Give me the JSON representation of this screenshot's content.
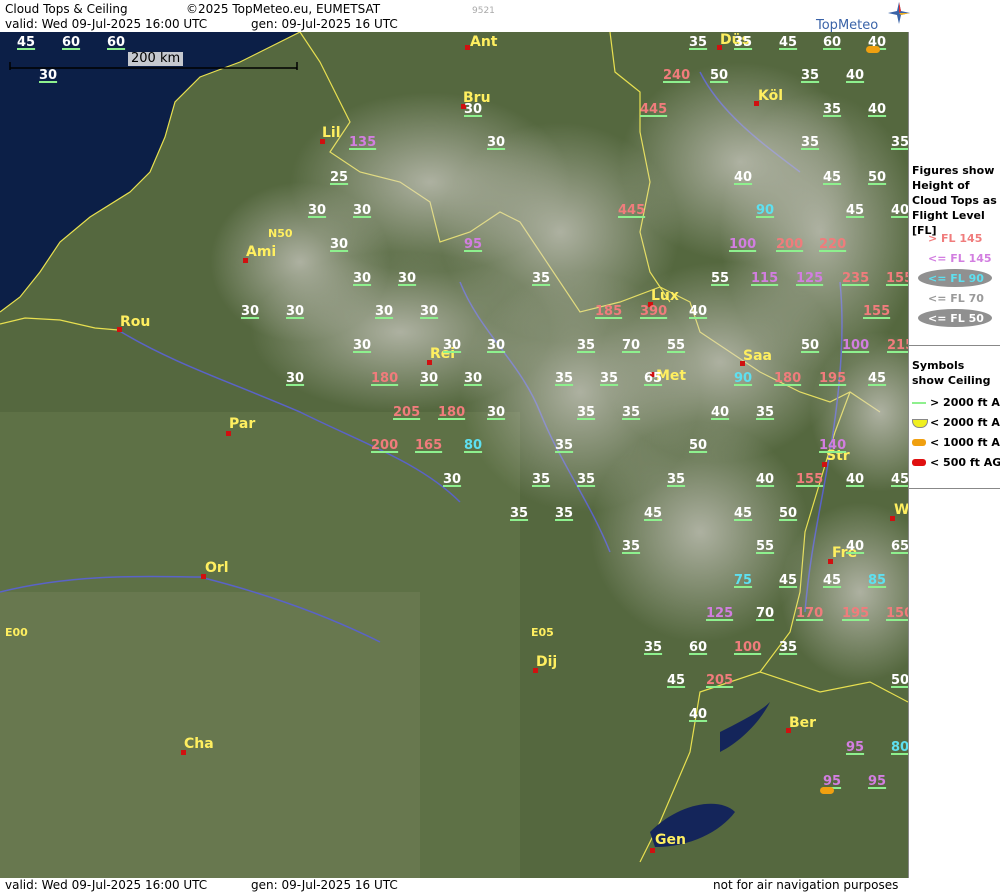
{
  "header": {
    "product": "Cloud Tops & Ceiling",
    "copyright": "©2025 TopMeteo.eu, EUMETSAT",
    "valid": "valid:  Wed  09-Jul-2025  16:00 UTC",
    "generated": "gen: 09-Jul-2025 16 UTC",
    "code": "9521",
    "logo": "TopMeteo"
  },
  "footer": {
    "valid": "valid:  Wed  09-Jul-2025  16:00 UTC",
    "generated": "gen: 09-Jul-2025 16 UTC",
    "disclaimer": "not for air navigation purposes"
  },
  "scale": {
    "label": "200 km"
  },
  "grid_labels": [
    "N50",
    "E00",
    "E05"
  ],
  "cities": [
    "Ant",
    "Düs",
    "Bru",
    "Köl",
    "Lil",
    "Ami",
    "Lux",
    "Rou",
    "Rei",
    "Saa",
    "Met",
    "Par",
    "Str",
    "Fre",
    "Orl",
    "Dij",
    "Ber",
    "Cha",
    "Gen",
    "W"
  ],
  "legend": {
    "fl_title": "Figures show Height of Cloud Tops as Flight Level  [FL]",
    "fl_items": [
      {
        "label": "> FL 145",
        "color": "#f07c7c",
        "bubble": ""
      },
      {
        "label": "<= FL 145",
        "color": "#d27ee0",
        "bubble": ""
      },
      {
        "label": "<= FL 90",
        "color": "#5ee0f0",
        "bubble": "#909090"
      },
      {
        "label": "<= FL 70",
        "color": "#9a9a9a",
        "bubble": ""
      },
      {
        "label": "<= FL 50",
        "color": "#ffffff",
        "bubble": "#909090"
      }
    ],
    "ceil_title": "Symbols show Ceiling",
    "ceil_items": [
      {
        "label": "> 2000 ft AGL",
        "color": "#8ef08e",
        "kind": "line"
      },
      {
        "label": "< 2000 ft AGL",
        "color": "#f0f020",
        "kind": "cup"
      },
      {
        "label": "< 1000 ft AGL",
        "color": "#f0a010",
        "kind": "pill"
      },
      {
        "label": "< 500 ft AGL",
        "color": "#e01010",
        "kind": "pill"
      }
    ]
  },
  "labels": [
    [
      "45",
      "w"
    ],
    [
      "60",
      "w"
    ],
    [
      "60",
      "w"
    ],
    [
      "30",
      "w"
    ],
    [
      "35",
      "w"
    ],
    [
      "35",
      "w"
    ],
    [
      "45",
      "w"
    ],
    [
      "60",
      "w"
    ],
    [
      "40",
      "w"
    ],
    [
      "240",
      "r"
    ],
    [
      "50",
      "w"
    ],
    [
      "35",
      "w"
    ],
    [
      "40",
      "w"
    ],
    [
      "30",
      "w"
    ],
    [
      "445",
      "r"
    ],
    [
      "35",
      "w"
    ],
    [
      "40",
      "w"
    ],
    [
      "135",
      "m"
    ],
    [
      "30",
      "w"
    ],
    [
      "35",
      "w"
    ],
    [
      "35",
      "w"
    ],
    [
      "25",
      "w"
    ],
    [
      "40",
      "w"
    ],
    [
      "45",
      "w"
    ],
    [
      "50",
      "w"
    ],
    [
      "30",
      "w"
    ],
    [
      "30",
      "w"
    ],
    [
      "445",
      "r"
    ],
    [
      "90",
      "c"
    ],
    [
      "45",
      "w"
    ],
    [
      "40",
      "w"
    ],
    [
      "30",
      "w"
    ],
    [
      "95",
      "m"
    ],
    [
      "100",
      "m"
    ],
    [
      "200",
      "r"
    ],
    [
      "220",
      "r"
    ],
    [
      "30",
      "w"
    ],
    [
      "30",
      "w"
    ],
    [
      "35",
      "w"
    ],
    [
      "55",
      "w"
    ],
    [
      "115",
      "m"
    ],
    [
      "125",
      "m"
    ],
    [
      "235",
      "r"
    ],
    [
      "155",
      "r"
    ],
    [
      "30",
      "w"
    ],
    [
      "30",
      "w"
    ],
    [
      "30",
      "w"
    ],
    [
      "30",
      "w"
    ],
    [
      "185",
      "r"
    ],
    [
      "390",
      "r"
    ],
    [
      "40",
      "w"
    ],
    [
      "155",
      "r"
    ],
    [
      "30",
      "w"
    ],
    [
      "30",
      "w"
    ],
    [
      "30",
      "w"
    ],
    [
      "35",
      "w"
    ],
    [
      "70",
      "w"
    ],
    [
      "55",
      "w"
    ],
    [
      "50",
      "w"
    ],
    [
      "100",
      "m"
    ],
    [
      "215",
      "r"
    ],
    [
      "30",
      "w"
    ],
    [
      "180",
      "r"
    ],
    [
      "30",
      "w"
    ],
    [
      "30",
      "w"
    ],
    [
      "35",
      "w"
    ],
    [
      "35",
      "w"
    ],
    [
      "65",
      "w"
    ],
    [
      "90",
      "c"
    ],
    [
      "180",
      "r"
    ],
    [
      "195",
      "r"
    ],
    [
      "45",
      "w"
    ],
    [
      "205",
      "r"
    ],
    [
      "180",
      "r"
    ],
    [
      "30",
      "w"
    ],
    [
      "35",
      "w"
    ],
    [
      "35",
      "w"
    ],
    [
      "40",
      "w"
    ],
    [
      "35",
      "w"
    ],
    [
      "200",
      "r"
    ],
    [
      "165",
      "r"
    ],
    [
      "80",
      "c"
    ],
    [
      "35",
      "w"
    ],
    [
      "50",
      "w"
    ],
    [
      "140",
      "m"
    ],
    [
      "30",
      "w"
    ],
    [
      "35",
      "w"
    ],
    [
      "35",
      "w"
    ],
    [
      "35",
      "w"
    ],
    [
      "40",
      "w"
    ],
    [
      "155",
      "r"
    ],
    [
      "40",
      "w"
    ],
    [
      "45",
      "w"
    ],
    [
      "35",
      "w"
    ],
    [
      "35",
      "w"
    ],
    [
      "45",
      "w"
    ],
    [
      "45",
      "w"
    ],
    [
      "50",
      "w"
    ],
    [
      "35",
      "w"
    ],
    [
      "55",
      "w"
    ],
    [
      "40",
      "w"
    ],
    [
      "65",
      "w"
    ],
    [
      "75",
      "c"
    ],
    [
      "45",
      "w"
    ],
    [
      "45",
      "w"
    ],
    [
      "85",
      "c"
    ],
    [
      "125",
      "m"
    ],
    [
      "70",
      "w"
    ],
    [
      "170",
      "r"
    ],
    [
      "195",
      "r"
    ],
    [
      "150",
      "r"
    ],
    [
      "35",
      "w"
    ],
    [
      "60",
      "w"
    ],
    [
      "100",
      "r"
    ],
    [
      "35",
      "w"
    ],
    [
      "45",
      "w"
    ],
    [
      "205",
      "r"
    ],
    [
      "40",
      "w"
    ],
    [
      "50",
      "w"
    ],
    [
      "95",
      "m"
    ],
    [
      "80",
      "c"
    ],
    [
      "95",
      "m"
    ],
    [
      "95",
      "m"
    ]
  ]
}
